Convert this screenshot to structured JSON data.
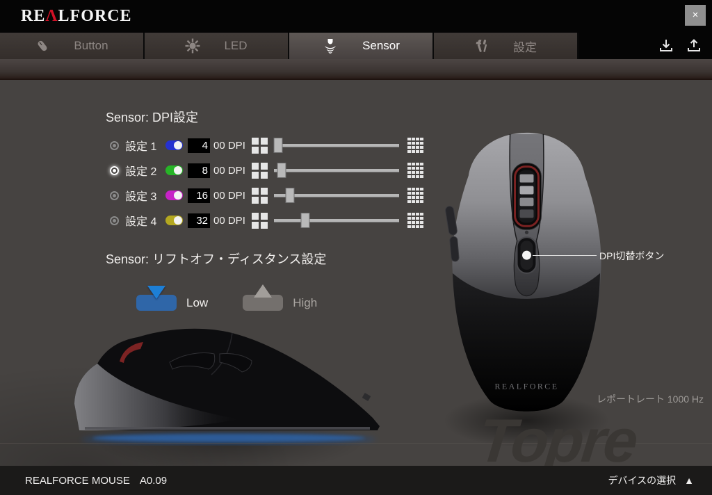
{
  "titlebar": {
    "brand_pre": "RE",
    "brand_lambda": "Λ",
    "brand_post": "LFORCE",
    "close_label": "×"
  },
  "tabs": [
    {
      "label": "Button",
      "icon": "mouse-icon",
      "active": false
    },
    {
      "label": "LED",
      "icon": "led-burst-icon",
      "active": false
    },
    {
      "label": "Sensor",
      "icon": "sensor-waves-icon",
      "active": true
    },
    {
      "label": "設定",
      "icon": "tools-icon",
      "active": false
    }
  ],
  "toolbar_icons": {
    "download": "download-icon",
    "upload": "upload-icon"
  },
  "sensor_page": {
    "dpi_heading": "Sensor: DPI設定",
    "dpi_suffix": "00 DPI",
    "dpi_rows": [
      {
        "label": "設定 1",
        "value": "4",
        "dpi": 400,
        "led_color": "#2531d0",
        "slider_pos": "3.1%",
        "selected": false
      },
      {
        "label": "設定 2",
        "value": "8",
        "dpi": 800,
        "led_color": "#27b427",
        "slider_pos": "6.3%",
        "selected": true
      },
      {
        "label": "設定 3",
        "value": "16",
        "dpi": 1600,
        "led_color": "#c722c7",
        "slider_pos": "12.5%",
        "selected": false
      },
      {
        "label": "設定 4",
        "value": "32",
        "dpi": 3200,
        "led_color": "#b4a820",
        "slider_pos": "25%",
        "selected": false
      }
    ],
    "liftoff_heading": "Sensor: リフトオフ・ディスタンス設定",
    "liftoff_low_label": "Low",
    "liftoff_high_label": "High",
    "liftoff_selected": "Low",
    "dpi_callout": "DPI切替ボタン",
    "report_rate": "レポートレート 1000 Hz",
    "mouse_brand": "REALFORCE"
  },
  "watermark": "Topre",
  "statusbar": {
    "device": "REALFORCE MOUSE",
    "version": "A0.09",
    "device_select": "デバイスの選択",
    "device_select_arrow": "▲"
  },
  "colors": {
    "accent_blue_button": "#2f66a8",
    "accent_blue_triangle": "#1d7fd6",
    "led_blue": "#2531d0",
    "led_green": "#27b427",
    "led_magenta": "#c722c7",
    "led_yellow": "#b4a820"
  }
}
